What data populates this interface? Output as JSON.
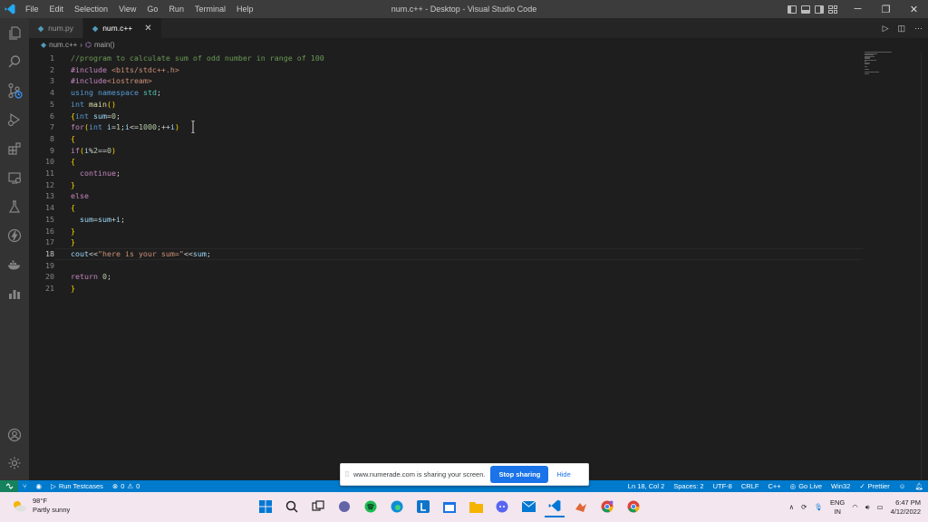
{
  "titlebar": {
    "menu": [
      "File",
      "Edit",
      "Selection",
      "View",
      "Go",
      "Run",
      "Terminal",
      "Help"
    ],
    "window_title": "num.c++ - Desktop - Visual Studio Code"
  },
  "tabs": [
    {
      "label": "num.py",
      "active": false
    },
    {
      "label": "num.c++",
      "active": true
    }
  ],
  "tab_close_glyph": "✕",
  "breadcrumb": {
    "file": "num.c++",
    "symbol": "main()"
  },
  "editor": {
    "current_line": 18,
    "lines": [
      {
        "n": "1",
        "text": "//program to calculate sum of odd number in range of 100"
      },
      {
        "n": "2",
        "text": "#include <bits/stdc++.h>"
      },
      {
        "n": "3",
        "text": "#include<iostream>"
      },
      {
        "n": "4",
        "text": "using namespace std;"
      },
      {
        "n": "5",
        "text": "int main()"
      },
      {
        "n": "6",
        "text": "{int sum=0;"
      },
      {
        "n": "7",
        "text": "for(int i=1;i<=1000;++i)"
      },
      {
        "n": "8",
        "text": "{"
      },
      {
        "n": "9",
        "text": "if(i%2==0)"
      },
      {
        "n": "10",
        "text": "{"
      },
      {
        "n": "11",
        "text": "  continue;"
      },
      {
        "n": "12",
        "text": "}"
      },
      {
        "n": "13",
        "text": "else"
      },
      {
        "n": "14",
        "text": "{"
      },
      {
        "n": "15",
        "text": "  sum=sum+i;"
      },
      {
        "n": "16",
        "text": "}"
      },
      {
        "n": "17",
        "text": "}"
      },
      {
        "n": "18",
        "text": "cout<<\"here is your sum=\"<<sum;"
      },
      {
        "n": "19",
        "text": ""
      },
      {
        "n": "20",
        "text": "return 0;"
      },
      {
        "n": "21",
        "text": "}"
      }
    ]
  },
  "statusbar": {
    "run_testcases": "Run Testcases",
    "errors": "0",
    "warnings": "0",
    "position": "Ln 18, Col 2",
    "spaces": "Spaces: 2",
    "encoding": "UTF-8",
    "eol": "CRLF",
    "language": "C++",
    "go_live": "Go Live",
    "platform": "Win32",
    "prettier": "Prettier"
  },
  "share_bar": {
    "message": "www.numerade.com is sharing your screen.",
    "stop_label": "Stop sharing",
    "hide_label": "Hide"
  },
  "taskbar": {
    "temperature": "98°F",
    "condition": "Partly sunny",
    "lang_line1": "ENG",
    "lang_line2": "IN",
    "time": "6:47 PM",
    "date": "4/12/2022"
  },
  "colors": {
    "accent": "#007acc",
    "titlebar": "#3c3c3c",
    "editor_bg": "#1e1e1e",
    "remote": "#16825d"
  }
}
